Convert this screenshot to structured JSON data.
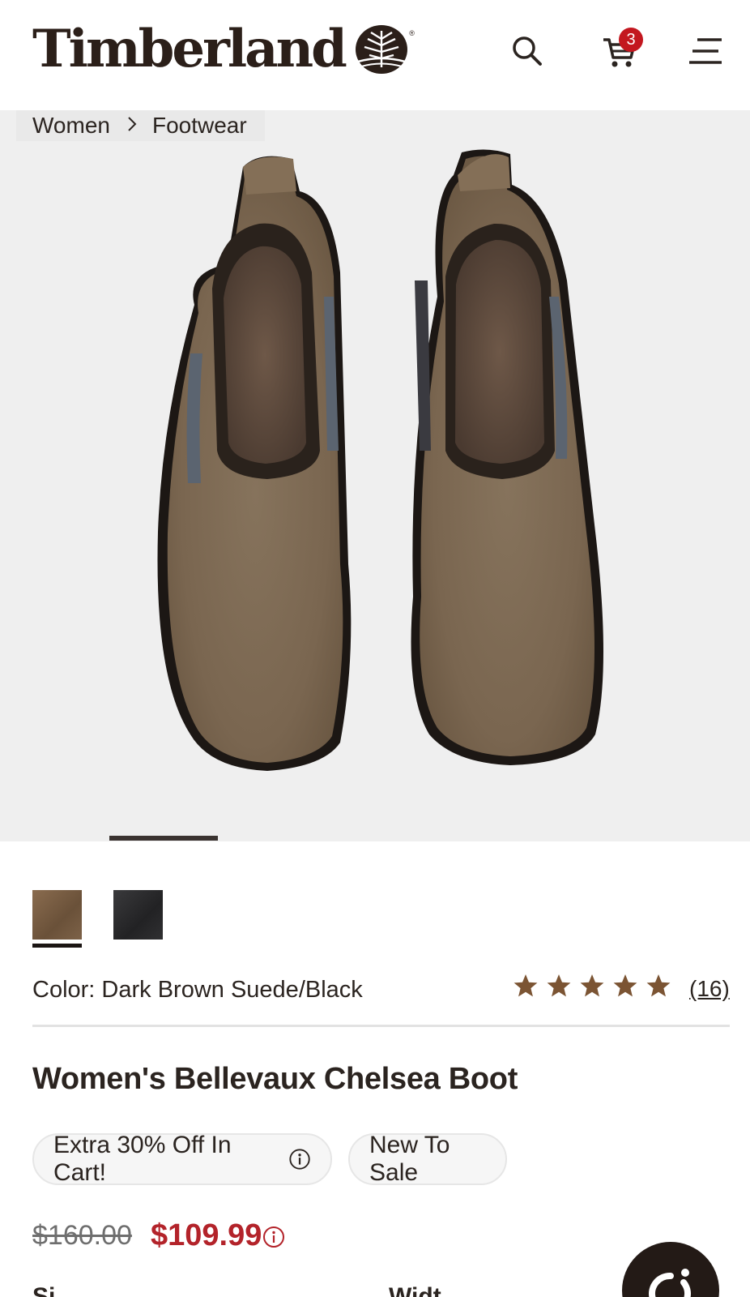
{
  "header": {
    "logo_text": "Timberland",
    "cart_count": "3"
  },
  "breadcrumb": {
    "items": [
      "Women",
      "Footwear"
    ],
    "separator": ">"
  },
  "hero": {
    "image_description_icon": "boots-image",
    "carousel_active_index": 1
  },
  "swatches": [
    {
      "color": "#7a6046"
    },
    {
      "color": "#2c2c2e"
    }
  ],
  "color": {
    "label": "Color: Dark Brown Suede/Black"
  },
  "rating": {
    "stars": 5,
    "review_count": "(16)",
    "star_color": "#7b5433"
  },
  "product": {
    "title": "Women's Bellevaux Chelsea Boot"
  },
  "badges": [
    {
      "label": "Extra 30% Off In Cart!"
    },
    {
      "label": "New To Sale"
    }
  ],
  "price": {
    "original": "$160.00",
    "sale": "$109.99"
  },
  "below_fold": {
    "size_label": "Si",
    "width_label": "Widt"
  },
  "colors": {
    "sale_red": "#b3232a",
    "badge_red": "#c3171f",
    "text_dark": "#2b2420"
  }
}
